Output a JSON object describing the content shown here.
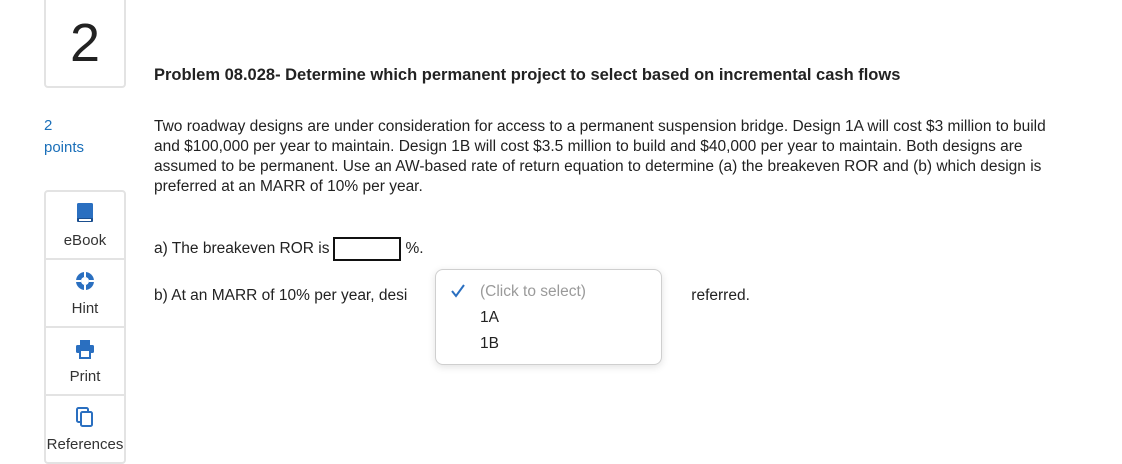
{
  "question": {
    "number": "2",
    "points_value": "2",
    "points_label": "points"
  },
  "tools": [
    {
      "label": "eBook",
      "icon": "book-icon"
    },
    {
      "label": "Hint",
      "icon": "hint-icon"
    },
    {
      "label": "Print",
      "icon": "printer-icon"
    },
    {
      "label": "References",
      "icon": "references-icon"
    }
  ],
  "problem": {
    "title": "Problem 08.028- Determine which permanent project to select based on incremental cash flows",
    "text": "Two roadway designs are under consideration for access to a permanent suspension bridge. Design 1A will cost $3 million to build and $100,000 per year to maintain. Design 1B will cost $3.5 million to build and $40,000 per year to maintain. Both designs are assumed to be permanent. Use an AW-based rate of return equation to determine (a) the breakeven ROR and (b) which design is preferred at an MARR of 10% per year."
  },
  "part_a": {
    "prefix": "a) The breakeven ROR is",
    "value": "",
    "suffix": "%."
  },
  "part_b": {
    "prefix": "b) At an MARR of 10% per year, desi",
    "suffix": "referred."
  },
  "dropdown": {
    "options": [
      "(Click to select)",
      "1A",
      "1B"
    ],
    "selected": "(Click to select)"
  },
  "colors": {
    "accent": "#1a6fb9",
    "border": "#e3e3e3"
  }
}
